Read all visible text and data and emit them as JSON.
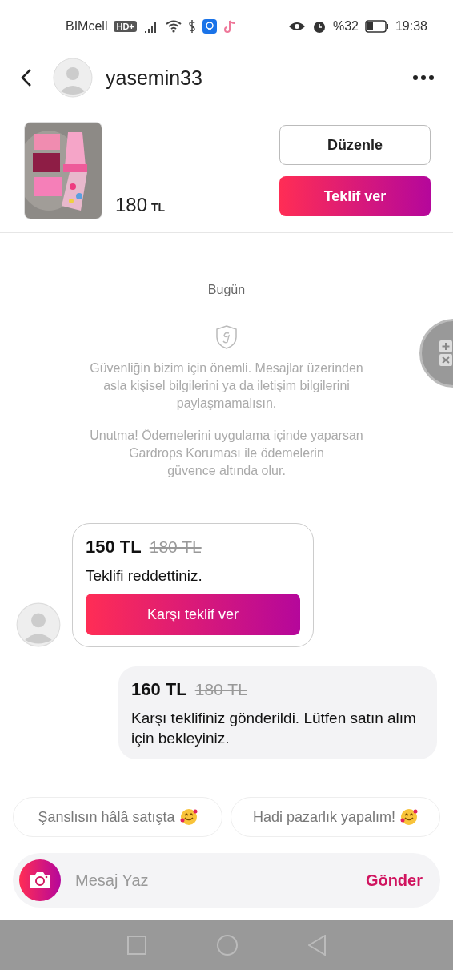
{
  "status_bar": {
    "carrier": "BIMcell",
    "network_badge": "HD+",
    "battery_text": "%32",
    "time": "19:38"
  },
  "header": {
    "username": "yasemin33"
  },
  "product": {
    "price": "180",
    "currency": "TL",
    "buttons": [
      {
        "label": "Düzenle",
        "kind": "outline"
      },
      {
        "label": "Teklif ver",
        "kind": "primary"
      }
    ]
  },
  "chat": {
    "date": "Bugün",
    "notices": [
      "Güvenliğin bizim için önemli. Mesajlar üzerinden\nasla kişisel bilgilerini ya da iletişim bilgilerini\npaylaşmamalısın.",
      "Unutma! Ödemelerini uygulama içinde yaparsan\nGardrops Koruması ile ödemelerin\ngüvence altında olur."
    ],
    "messages": [
      {
        "kind": "incoming",
        "offer": "150 TL",
        "old_price": "180 TL",
        "text": "Teklifi reddettiniz.",
        "action": "Karşı teklif ver"
      },
      {
        "kind": "outgoing",
        "offer": "160 TL",
        "old_price": "180 TL",
        "text": "Karşı teklifiniz gönderildi. Lütfen satın alım için bekleyiniz."
      }
    ]
  },
  "quick_replies": [
    "Şanslısın hâlâ satışta",
    "Hadi pazarlık yapalım!"
  ],
  "composer": {
    "placeholder": "Mesaj Yaz",
    "send": "Gönder"
  }
}
